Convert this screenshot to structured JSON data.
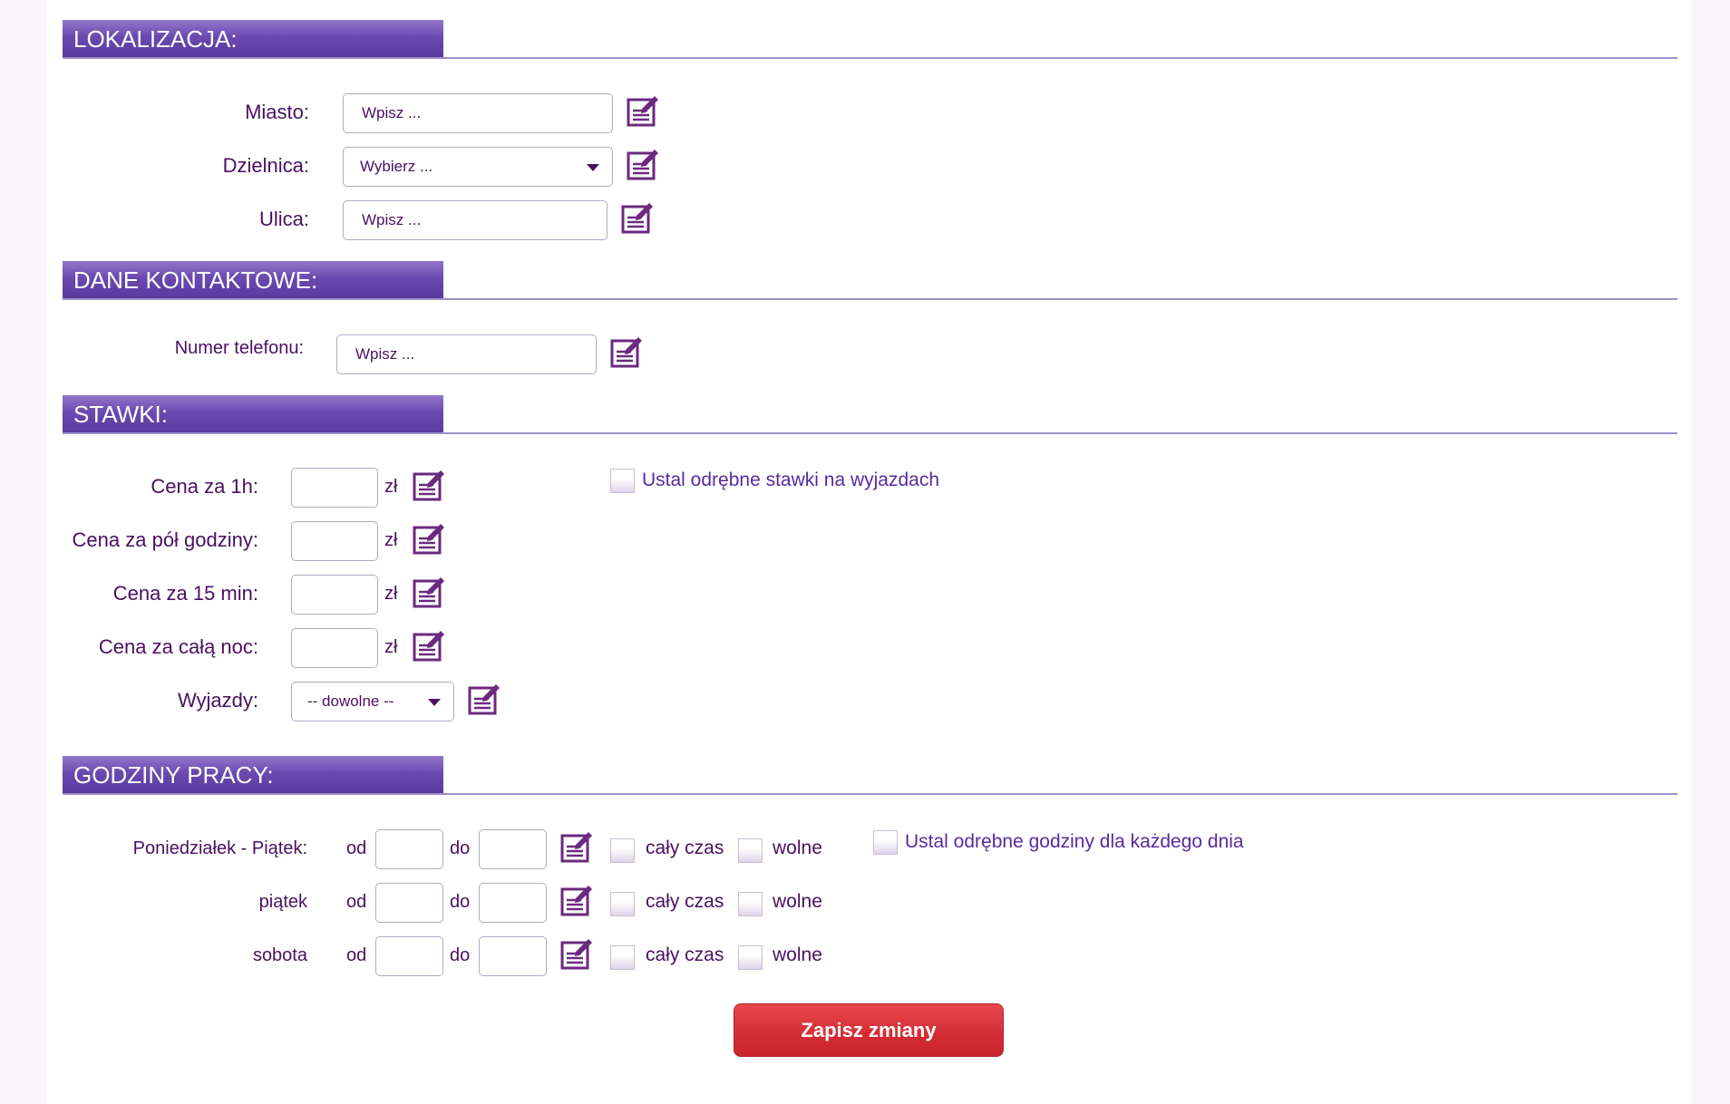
{
  "sections": {
    "location": "LOKALIZACJA:",
    "contact": "DANE KONTAKTOWE:",
    "rates": "STAWKI:",
    "hours": "GODZINY PRACY:"
  },
  "location": {
    "city_label": "Miasto:",
    "city_value": "Wpisz ...",
    "district_label": "Dzielnica:",
    "district_value": "Wybierz ...",
    "street_label": "Ulica:",
    "street_value": "Wpisz ..."
  },
  "contact": {
    "phone_label": "Numer telefonu:",
    "phone_value": "Wpisz ..."
  },
  "rates": {
    "items": [
      {
        "label": "Cena za 1h:",
        "unit": "zł",
        "value": ""
      },
      {
        "label": "Cena za pół godziny:",
        "unit": "zł",
        "value": ""
      },
      {
        "label": "Cena za 15 min:",
        "unit": "zł",
        "value": ""
      },
      {
        "label": "Cena za całą noc:",
        "unit": "zł",
        "value": ""
      }
    ],
    "trips_label": "Wyjazdy:",
    "trips_value": "-- dowolne --",
    "separate_rates_label": "Ustal odrębne stawki na wyjazdach"
  },
  "hours": {
    "from": "od",
    "to": "do",
    "all_time": "cały czas",
    "day_off": "wolne",
    "separate_hours_label": "Ustal odrębne godziny dla każdego dnia",
    "rows": [
      {
        "label": "Poniedziałek - Piątek:"
      },
      {
        "label": "piątek"
      },
      {
        "label": "sobota"
      }
    ]
  },
  "save_label": "Zapisz zmiany",
  "icons": {
    "edit": "edit-note-icon",
    "dropdown": "caret-down-icon"
  },
  "colors": {
    "accent": "#6a49b0",
    "text": "#4a1060",
    "button": "#d42c34"
  }
}
